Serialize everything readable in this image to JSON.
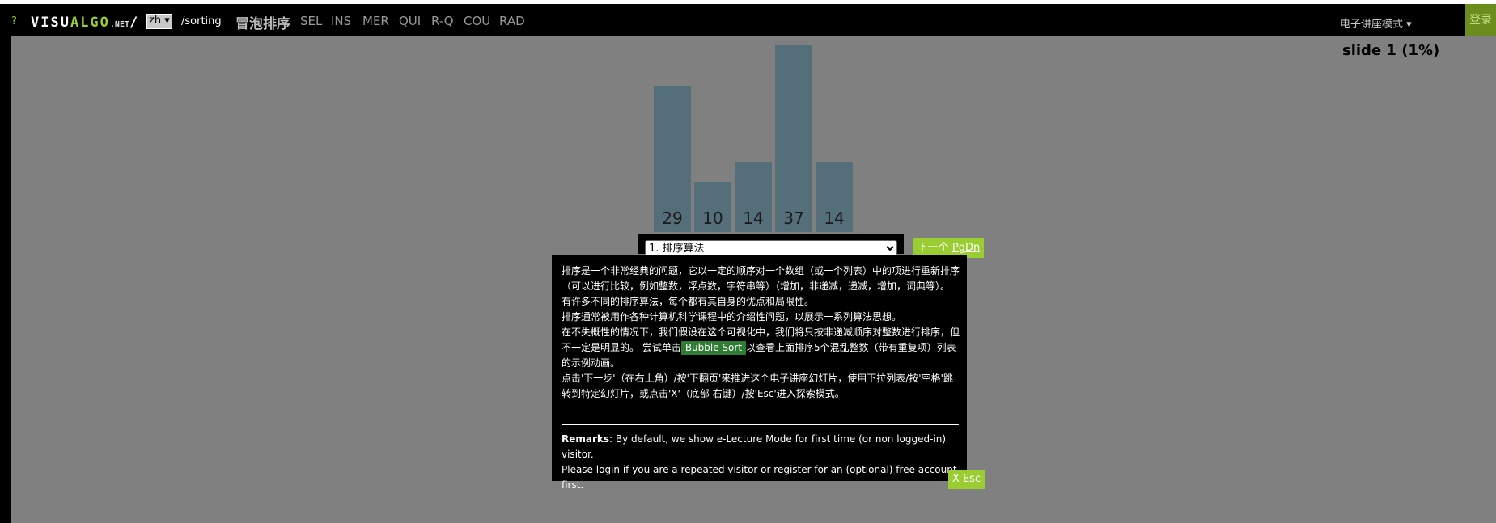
{
  "header": {
    "help": "?",
    "logo_visu": "VISU",
    "logo_algo": "ALGO",
    "logo_net": ".NET",
    "logo_slash": "/",
    "lang": "zh ▾",
    "path": "/sorting",
    "current_algo": "冒泡排序",
    "algos": [
      "SEL",
      "INS",
      "MER",
      "QUI",
      "R-Q",
      "COU",
      "RAD"
    ],
    "mode": "电子讲座模式 ▾",
    "login": "登录"
  },
  "slide_label": "slide 1 (1%)",
  "bars": {
    "values": [
      29,
      10,
      14,
      37,
      14
    ],
    "labels": [
      "29",
      "10",
      "14",
      "37",
      "14"
    ]
  },
  "controls": {
    "slide_select": "1. 排序算法",
    "next_label": "下一个 ",
    "next_key": "PgDn"
  },
  "panel": {
    "p1": "排序是一个非常经典的问题，它以一定的顺序对一个数组（或一个列表）中的项进行重新排序（可以进行比较，例如整数，浮点数，字符串等）（增加，非递减，递减，增加，词典等）。",
    "p2": "有许多不同的排序算法，每个都有其自身的优点和局限性。",
    "p3": "排序通常被用作各种计算机科学课程中的介绍性问题，以展示一系列算法思想。",
    "p4_pre": "在不失概性的情况下，我们假设在这个可视化中，我们将只按非递减顺序对整数进行排序，但不一定是明显的。 尝试单击",
    "p4_chip": "Bubble Sort",
    "p4_post": "以查看上面排序5个混乱整数（带有重复项）列表的示例动画。",
    "p5": "点击'下一步'（在右上角）/按'下翻页'来推进这个电子讲座幻灯片，使用下拉列表/按'空格'跳转到特定幻灯片，或点击'X'（底部 右键）/按'Esc'进入探索模式。",
    "remarks_label": "Remarks",
    "remarks_1": ": By default, we show e-Lecture Mode for first time (or non logged-in) visitor.",
    "remarks_2": "Please ",
    "remarks_login": "login",
    "remarks_3": " if you are a repeated visitor or ",
    "remarks_register": "register",
    "remarks_4": " for an (optional) free account first.",
    "esc_x": "X ",
    "esc_key": "Esc"
  }
}
